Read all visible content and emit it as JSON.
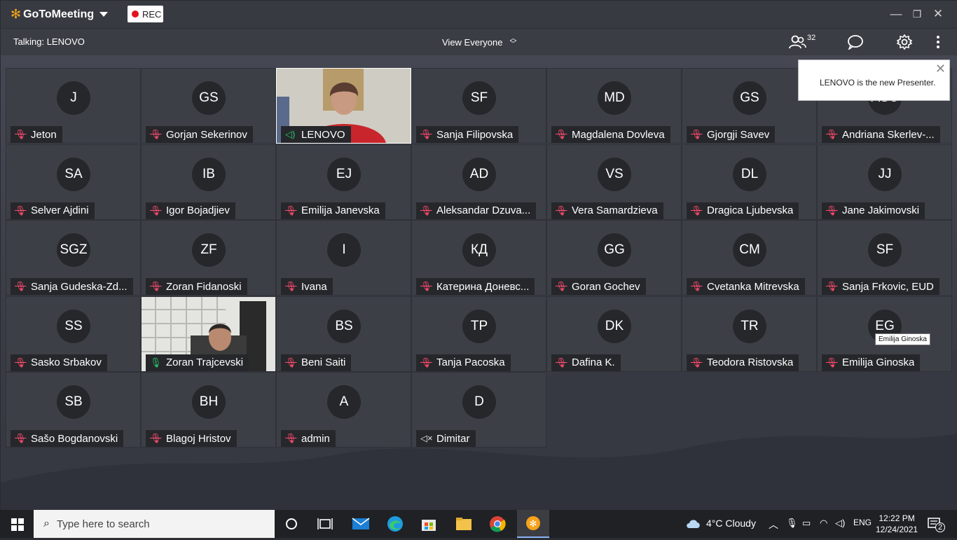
{
  "app": {
    "brand": "GoToMeeting",
    "rec_label": "REC"
  },
  "toolbar": {
    "talking": "Talking: LENOVO",
    "view": "View Everyone",
    "participant_count": "32"
  },
  "popup": {
    "message": "LENOVO is the new Presenter."
  },
  "tooltip": "Emilija Ginoska",
  "tiles": [
    {
      "initials": "J",
      "name": "Jeton",
      "state": "muted"
    },
    {
      "initials": "GS",
      "name": "Gorjan Sekerinov",
      "state": "muted"
    },
    {
      "initials": "",
      "name": "LENOVO",
      "state": "speaking",
      "video": "woman"
    },
    {
      "initials": "SF",
      "name": "Sanja Filipovska",
      "state": "muted"
    },
    {
      "initials": "MD",
      "name": "Magdalena Dovleva",
      "state": "muted"
    },
    {
      "initials": "GS",
      "name": "Gjorgji Savev",
      "state": "muted"
    },
    {
      "initials": "ASC",
      "name": "Andriana Skerlev-...",
      "state": "muted"
    },
    {
      "initials": "SA",
      "name": "Selver Ajdini",
      "state": "muted"
    },
    {
      "initials": "IB",
      "name": "Igor Bojadjiev",
      "state": "muted"
    },
    {
      "initials": "EJ",
      "name": "Emilija Janevska",
      "state": "muted"
    },
    {
      "initials": "AD",
      "name": "Aleksandar Dzuva...",
      "state": "muted"
    },
    {
      "initials": "VS",
      "name": "Vera Samardzieva",
      "state": "muted"
    },
    {
      "initials": "DL",
      "name": "Dragica Ljubevska",
      "state": "muted"
    },
    {
      "initials": "JJ",
      "name": "Jane Jakimovski",
      "state": "muted"
    },
    {
      "initials": "SGZ",
      "name": "Sanja Gudeska-Zd...",
      "state": "muted"
    },
    {
      "initials": "ZF",
      "name": "Zoran Fidanoski",
      "state": "muted"
    },
    {
      "initials": "I",
      "name": "Ivana",
      "state": "muted"
    },
    {
      "initials": "КД",
      "name": "Катерина Доневс...",
      "state": "muted"
    },
    {
      "initials": "GG",
      "name": "Goran Gochev",
      "state": "muted"
    },
    {
      "initials": "CM",
      "name": "Cvetanka Mitrevska",
      "state": "muted"
    },
    {
      "initials": "SF",
      "name": "Sanja Frkovic, EUD",
      "state": "muted"
    },
    {
      "initials": "SS",
      "name": "Sasko Srbakov",
      "state": "muted"
    },
    {
      "initials": "",
      "name": "Zoran Trajcevski",
      "state": "mic",
      "video": "man"
    },
    {
      "initials": "BS",
      "name": "Beni Saiti",
      "state": "muted"
    },
    {
      "initials": "TP",
      "name": "Tanja Pacoska",
      "state": "muted"
    },
    {
      "initials": "DK",
      "name": "Dafina K.",
      "state": "muted"
    },
    {
      "initials": "TR",
      "name": "Teodora Ristovska",
      "state": "muted"
    },
    {
      "initials": "EG",
      "name": "Emilija Ginoska",
      "state": "muted"
    },
    {
      "initials": "SB",
      "name": "Sašo Bogdanovski",
      "state": "muted"
    },
    {
      "initials": "BH",
      "name": "Blagoj Hristov",
      "state": "muted"
    },
    {
      "initials": "A",
      "name": "admin",
      "state": "muted"
    },
    {
      "initials": "D",
      "name": "Dimitar",
      "state": "audio-off"
    }
  ],
  "taskbar": {
    "search_placeholder": "Type here to search",
    "weather": "4°C  Cloudy",
    "lang": "ENG",
    "time": "12:22 PM",
    "date": "12/24/2021",
    "notifications": "2"
  }
}
